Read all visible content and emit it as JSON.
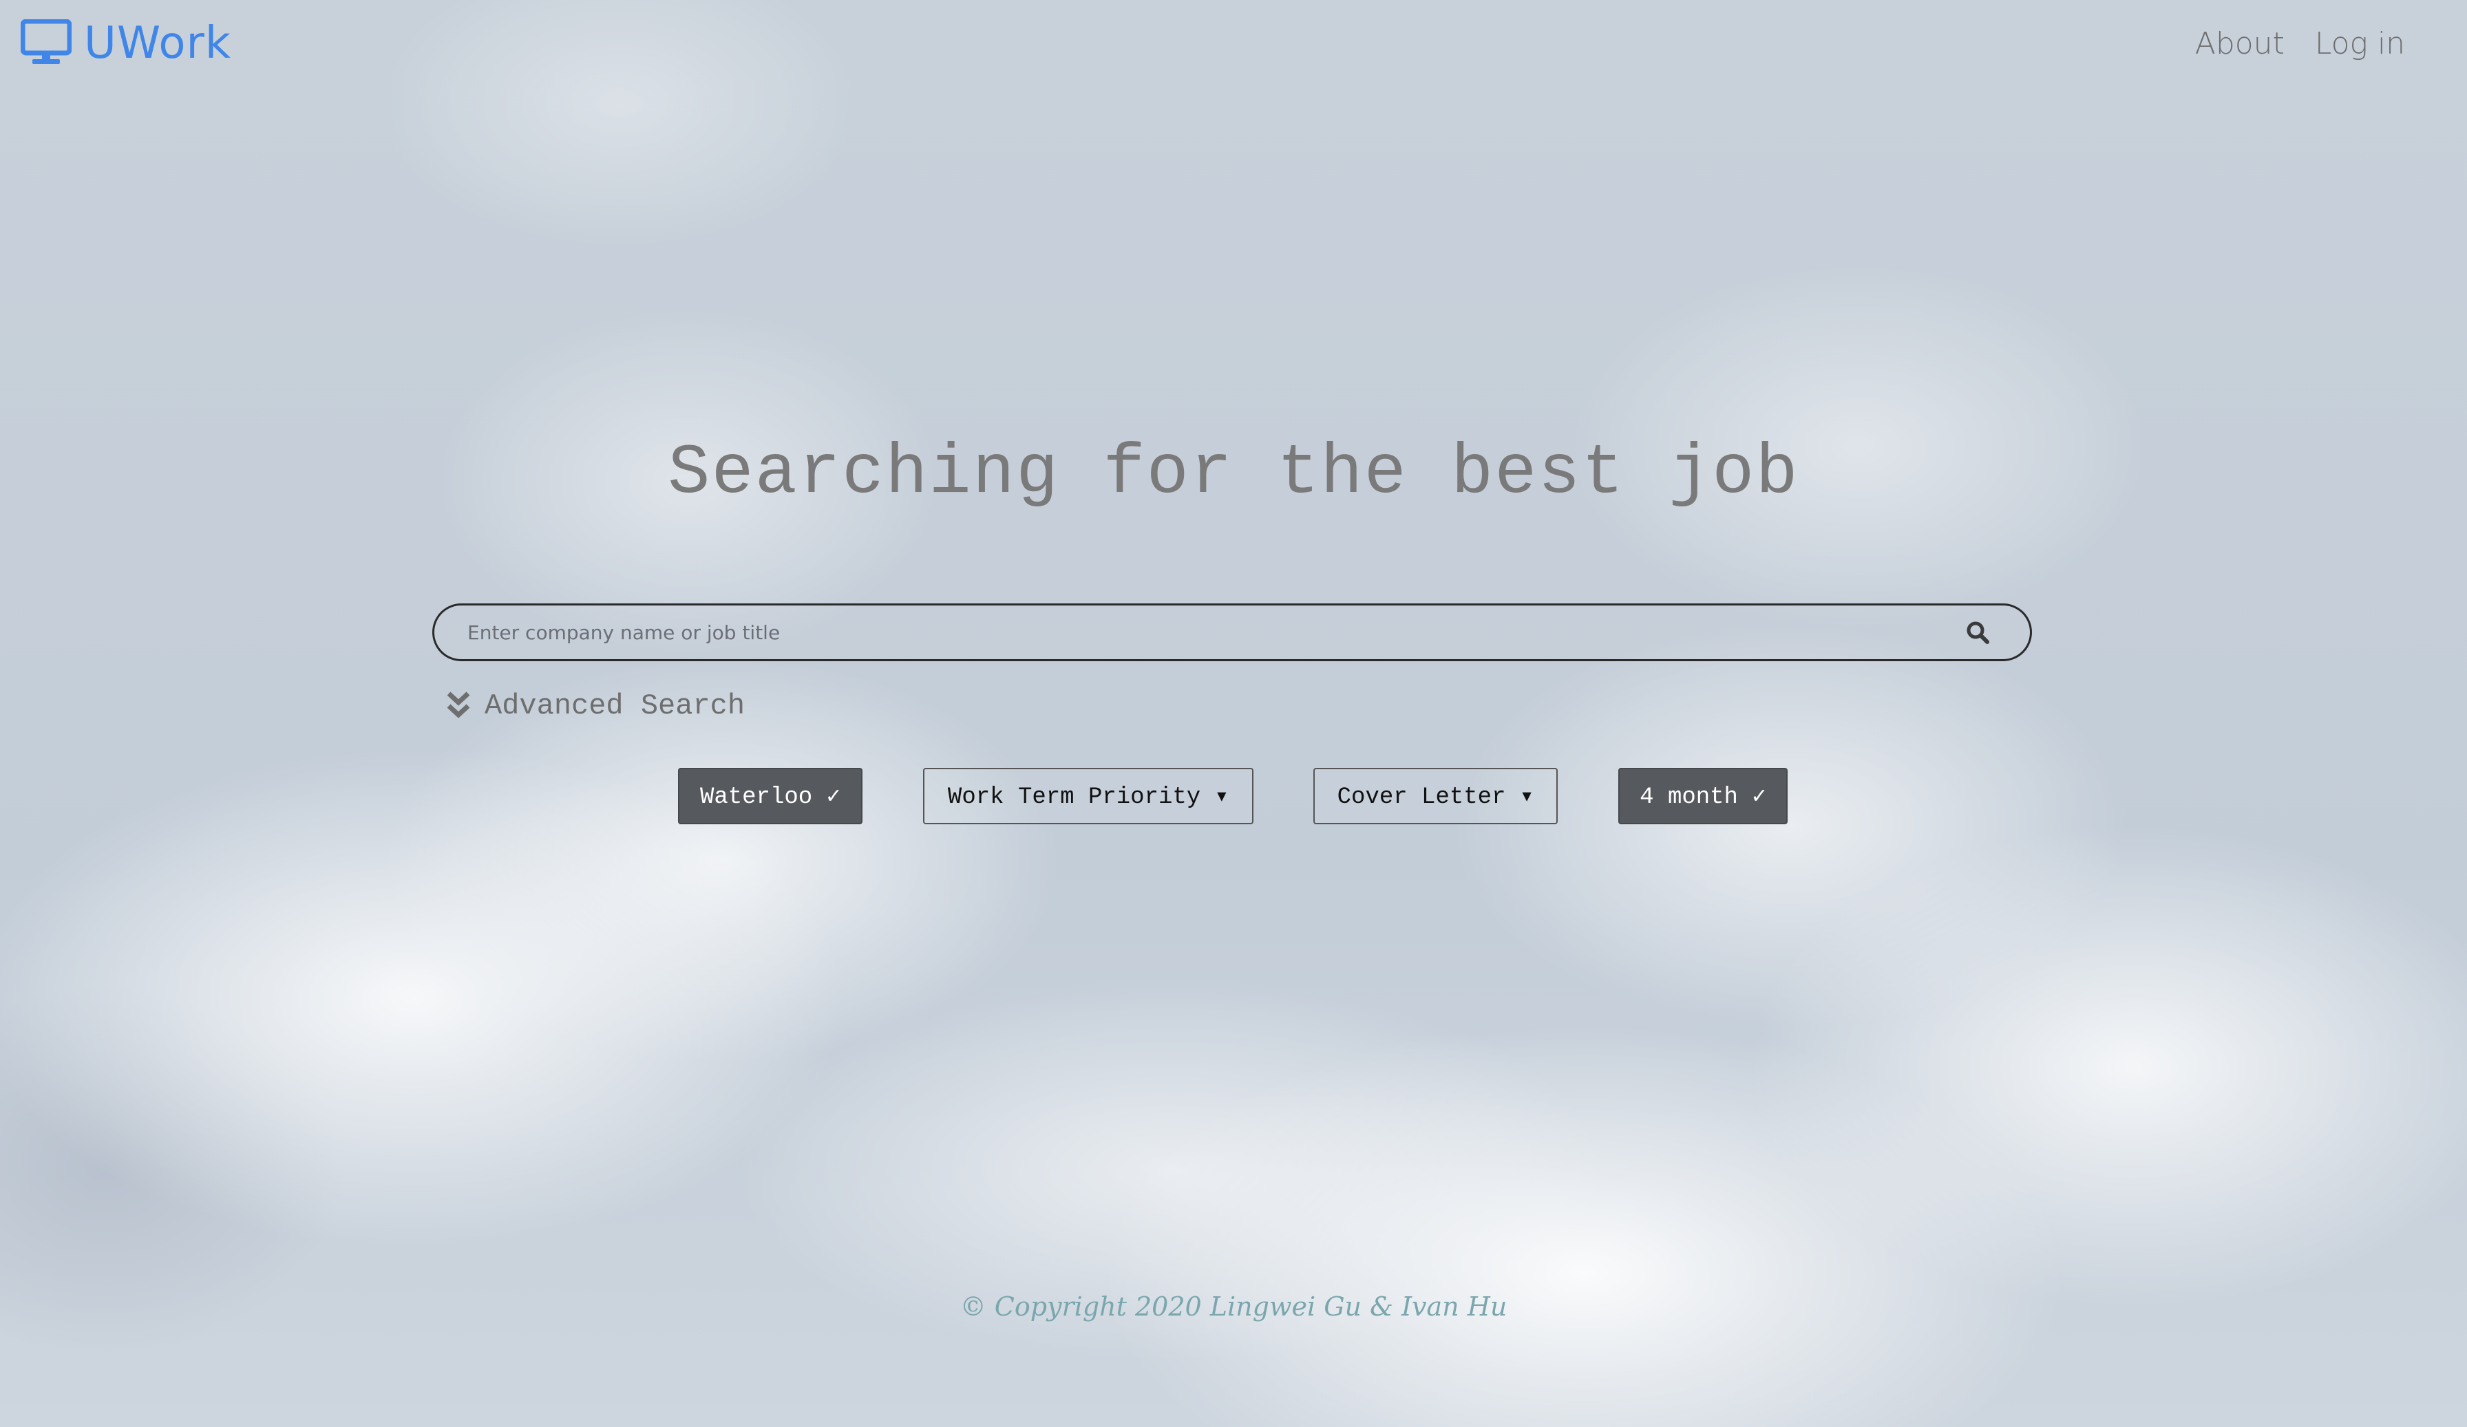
{
  "header": {
    "brand_name": "UWork",
    "brand_icon": "monitor-icon",
    "brand_color": "#3f86e8",
    "nav": {
      "about": "About",
      "login": "Log in"
    }
  },
  "hero": {
    "title": "Searching for the best job"
  },
  "search": {
    "placeholder": "Enter company name or job title",
    "value": "",
    "icon": "search-icon"
  },
  "advanced_search": {
    "label": "Advanced Search",
    "icon": "double-chevron-down-icon"
  },
  "filters": [
    {
      "label": "Waterloo ✓",
      "state": "selected"
    },
    {
      "label": "Work Term Priority ▾",
      "state": "unselected"
    },
    {
      "label": "Cover Letter ▾",
      "state": "unselected"
    },
    {
      "label": "4 month ✓",
      "state": "selected"
    }
  ],
  "footer": {
    "copyright": "© Copyright 2020 Lingwei Gu & Ivan Hu"
  },
  "colors": {
    "accent": "#3f86e8",
    "selected_filter_bg": "#56595e",
    "footer_text": "#7aa6ad"
  }
}
